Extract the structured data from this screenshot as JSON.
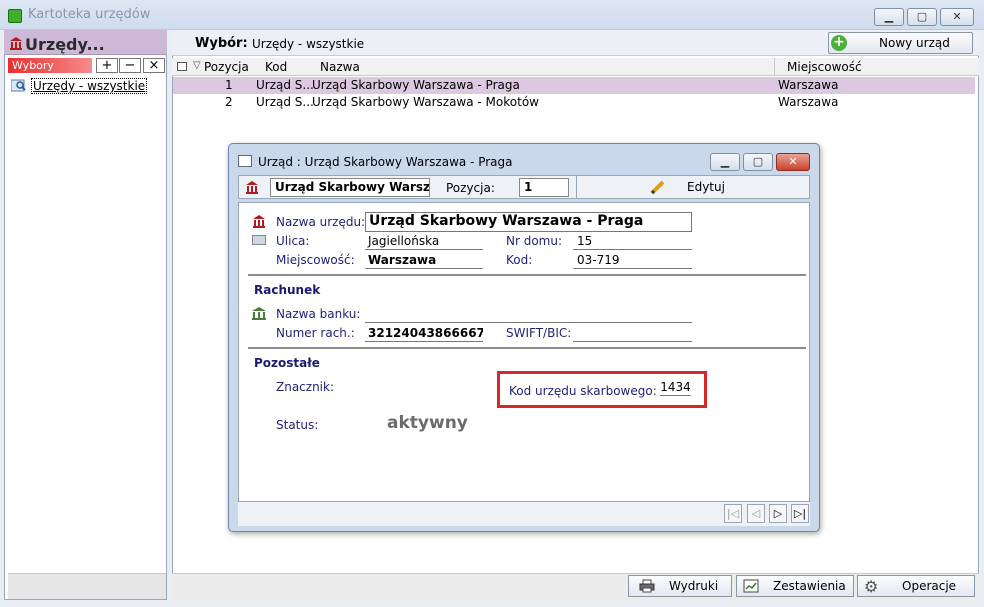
{
  "window": {
    "title": "Kartoteka urzędów",
    "min": "▁",
    "max": "▢",
    "close": "✕"
  },
  "left": {
    "title": "Urzędy...",
    "tab_label": "Wybory",
    "add": "+",
    "remove": "−",
    "close": "×",
    "item": "Urzędy - wszystkie"
  },
  "right": {
    "wybor_label": "Wybór:",
    "wybor_value": "Urzędy - wszystkie",
    "new_button": "Nowy urząd",
    "columns": [
      "Pozycja",
      "Kod",
      "Nazwa",
      "Miejscowość"
    ],
    "rows": [
      {
        "pos": "1",
        "kod": "Urząd S...",
        "nazwa": "Urząd Skarbowy Warszawa - Praga",
        "miejsc": "Warszawa"
      },
      {
        "pos": "2",
        "kod": "Urząd S...",
        "nazwa": "Urząd Skarbowy Warszawa - Mokotów",
        "miejsc": "Warszawa"
      }
    ]
  },
  "dialog": {
    "title": "Urząd : Urząd Skarbowy Warszawa - Praga",
    "toolbar": {
      "name_field": "Urząd Skarbowy Warsza...",
      "pozycja_label": "Pozycja:",
      "pozycja_value": "1",
      "edit_label": "Edytuj"
    },
    "fields": {
      "nazwa_label": "Nazwa urzędu:",
      "nazwa_value": "Urząd Skarbowy Warszawa - Praga",
      "ulica_label": "Ulica:",
      "ulica_value": "Jagiellońska",
      "nrdomu_label": "Nr domu:",
      "nrdomu_value": "15",
      "miejsc_label": "Miejscowość:",
      "miejsc_value": "Warszawa",
      "kod_label": "Kod:",
      "kod_value": "03-719"
    },
    "rachunek": {
      "section": "Rachunek",
      "bank_label": "Nazwa banku:",
      "bank_value": "",
      "numer_label": "Numer rach.:",
      "numer_value": "32124043866667...",
      "swift_label": "SWIFT/BIC:",
      "swift_value": ""
    },
    "pozostale": {
      "section": "Pozostałe",
      "znacznik_label": "Znacznik:",
      "kod_us_label": "Kod urzędu skarbowego:",
      "kod_us_value": "1434",
      "status_label": "Status:",
      "status_value": "aktywny"
    },
    "nav": {
      "first": "|◁",
      "prev": "◁",
      "next": "▷",
      "last": "▷|"
    }
  },
  "bottom": {
    "wydruki": "Wydruki",
    "zestawienia": "Zestawienia",
    "operacje": "Operacje"
  },
  "colors": {
    "selection": "#dcc8e0",
    "highlight_box": "#d62828",
    "accent": "#cdb8d8"
  }
}
